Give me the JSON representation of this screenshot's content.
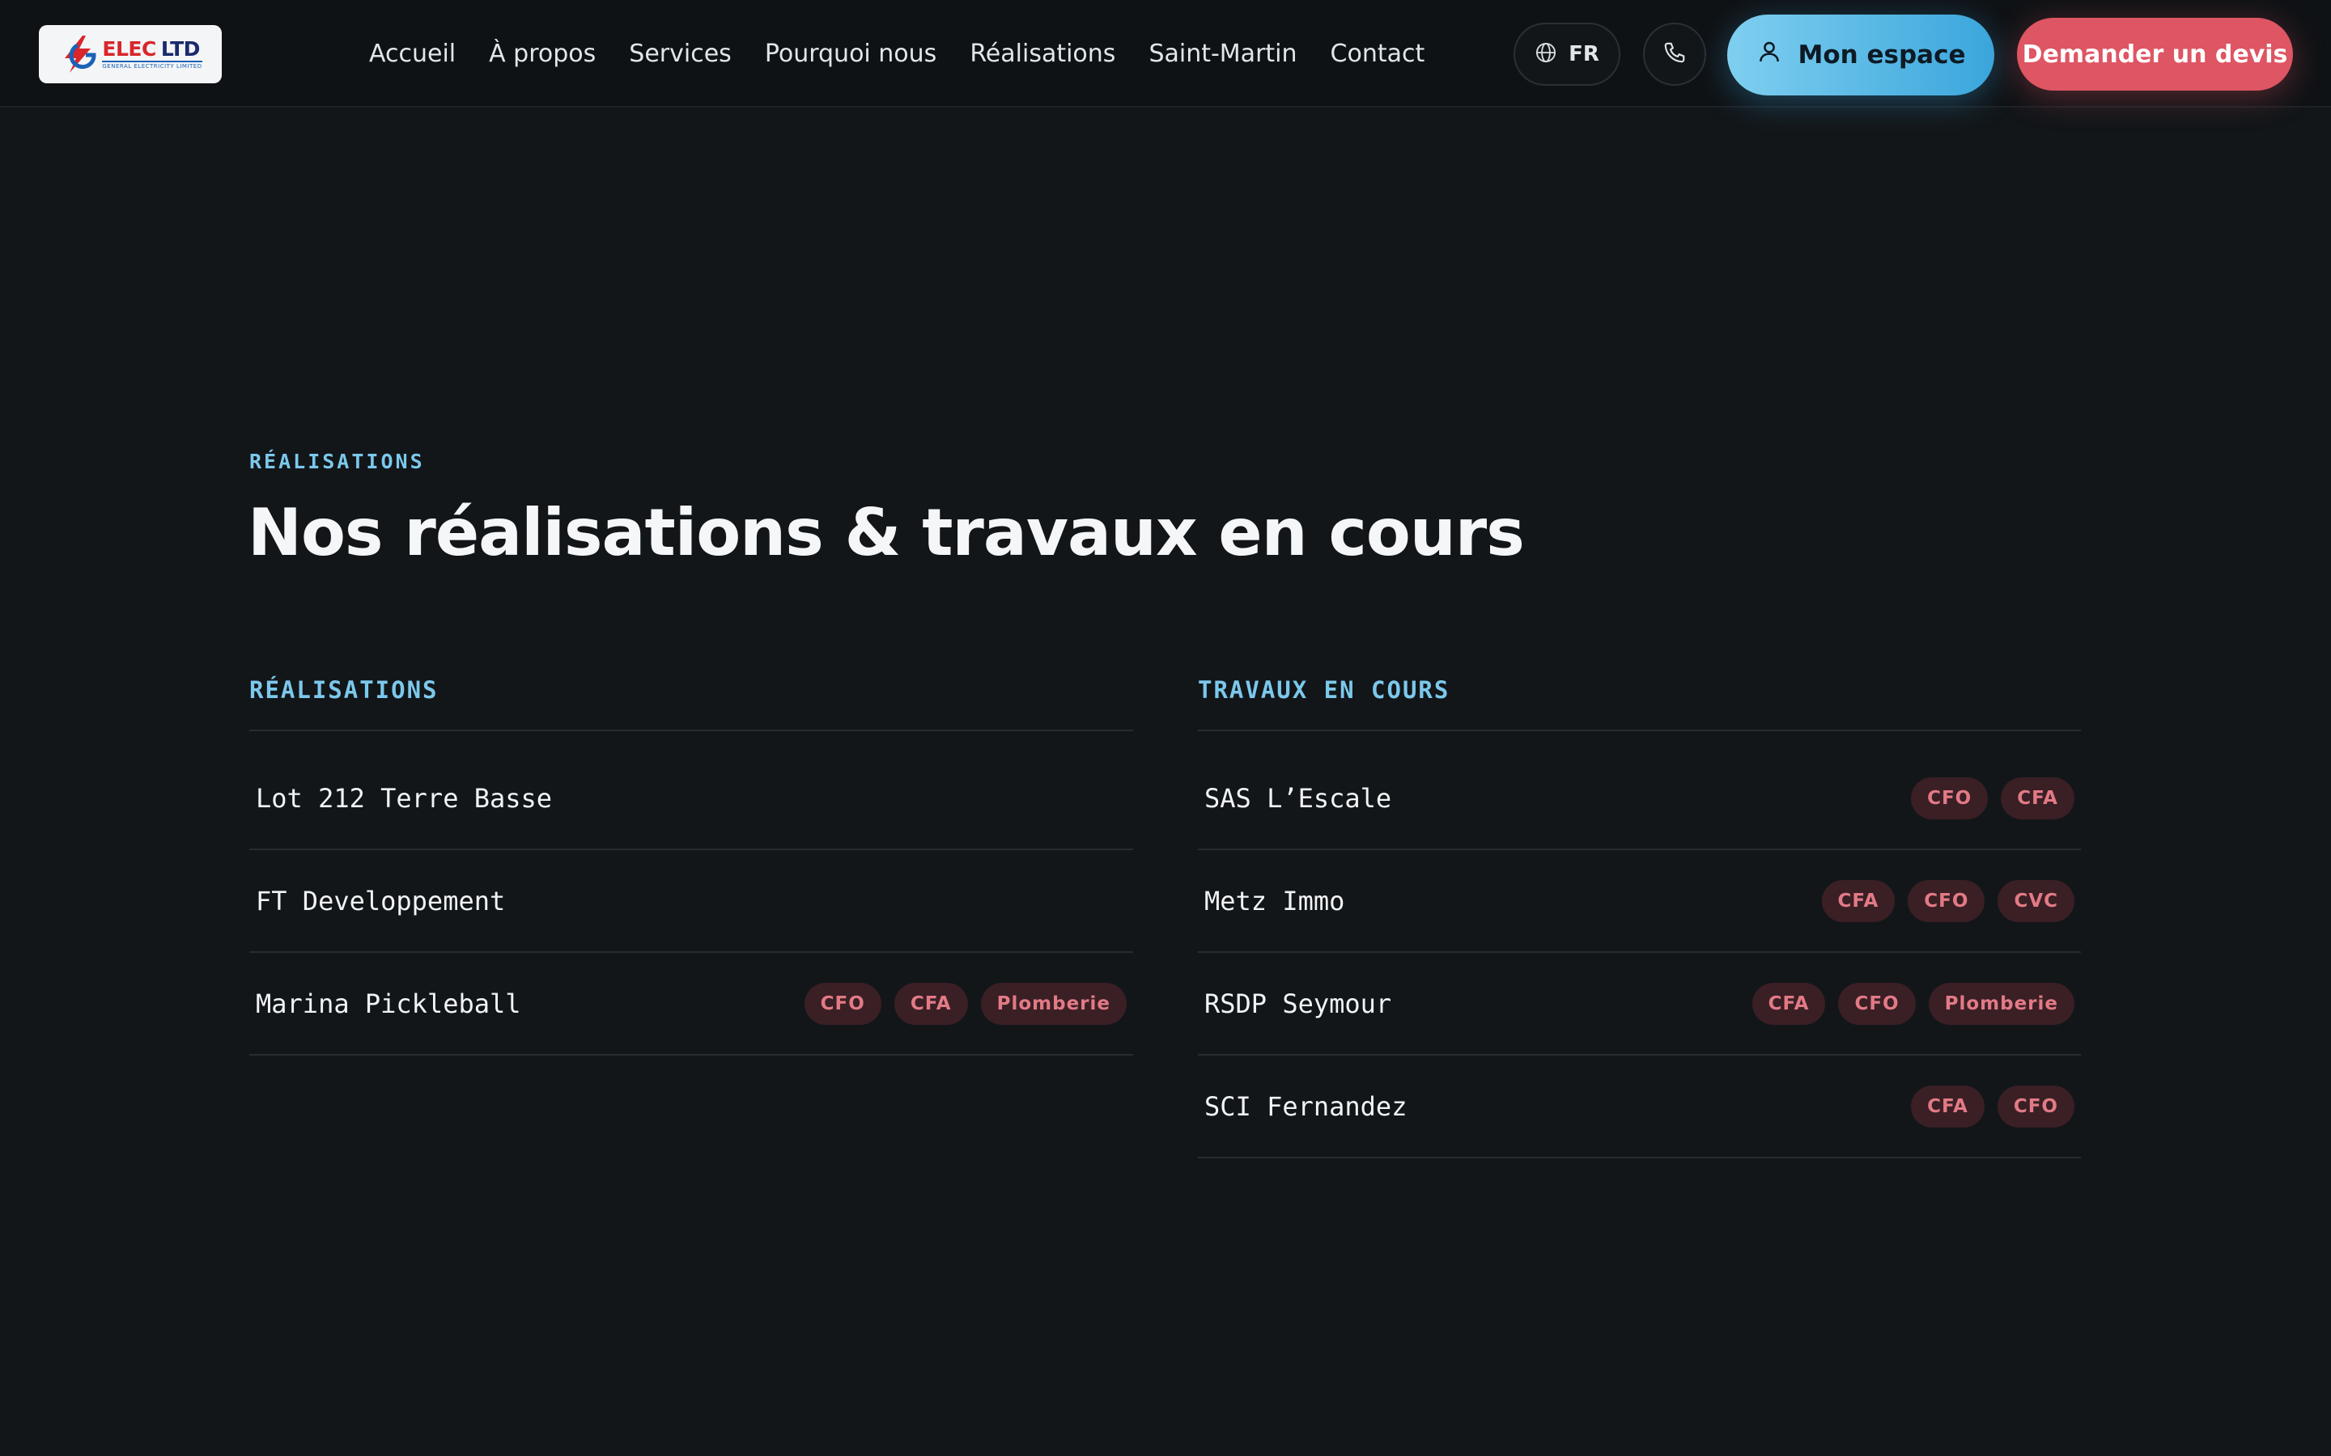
{
  "header": {
    "logo": {
      "name": "ELEC",
      "suffix": "LTD",
      "tagline": "GENERAL ELECTRICITY LIMITED"
    },
    "nav": [
      {
        "label": "Accueil"
      },
      {
        "label": "À propos"
      },
      {
        "label": "Services"
      },
      {
        "label": "Pourquoi nous"
      },
      {
        "label": "Réalisations"
      },
      {
        "label": "Saint-Martin"
      },
      {
        "label": "Contact"
      }
    ],
    "language": "FR",
    "espace_label": "Mon espace",
    "devis_label": "Demander un devis"
  },
  "section": {
    "eyebrow": "RÉALISATIONS",
    "title": "Nos réalisations & travaux en cours",
    "realisations": {
      "heading": "RÉALISATIONS",
      "items": [
        {
          "name": "Lot 212 Terre Basse",
          "tags": []
        },
        {
          "name": "FT Developpement",
          "tags": []
        },
        {
          "name": "Marina Pickleball",
          "tags": [
            "CFO",
            "CFA",
            "Plomberie"
          ]
        }
      ]
    },
    "travaux": {
      "heading": "TRAVAUX EN COURS",
      "items": [
        {
          "name": "SAS L’Escale",
          "tags": [
            "CFO",
            "CFA"
          ]
        },
        {
          "name": "Metz Immo",
          "tags": [
            "CFA",
            "CFO",
            "CVC"
          ]
        },
        {
          "name": "RSDP Seymour",
          "tags": [
            "CFA",
            "CFO",
            "Plomberie"
          ]
        },
        {
          "name": "SCI Fernandez",
          "tags": [
            "CFA",
            "CFO"
          ]
        }
      ]
    }
  },
  "colors": {
    "background": "#121619",
    "accent_blue": "#7cc8ec",
    "accent_red": "#de5563",
    "tag_bg": "#3a1f25",
    "tag_text": "#e27a85"
  },
  "icons": {
    "language": "globe-icon",
    "phone": "phone-icon",
    "espace": "user-icon",
    "logo": "lightning-bolt-icon"
  }
}
